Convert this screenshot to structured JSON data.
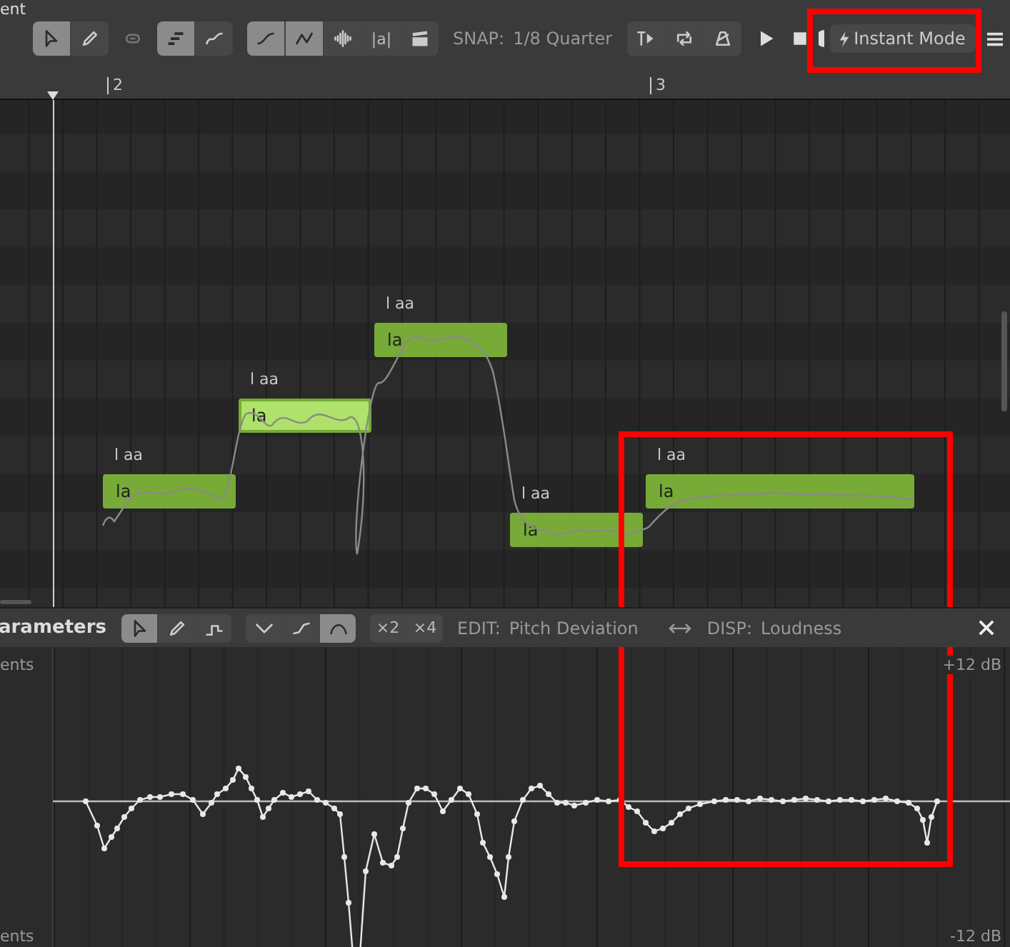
{
  "window": {
    "title": "ent"
  },
  "toolbar": {
    "groups": [
      {
        "tools": [
          {
            "kind": "select",
            "selected": true
          },
          {
            "kind": "pencil",
            "selected": false
          }
        ]
      },
      {
        "tools": [
          {
            "kind": "notes",
            "selected": true
          },
          {
            "kind": "pitch",
            "selected": false
          }
        ]
      },
      {
        "tools": [
          {
            "kind": "curve-smooth",
            "selected": true
          },
          {
            "kind": "curve-sharp",
            "selected": true
          },
          {
            "kind": "wave",
            "selected": false
          },
          {
            "kind": "text",
            "label": "|a|",
            "selected": false
          },
          {
            "kind": "clapper",
            "selected": false
          }
        ]
      }
    ],
    "snap_label": "SNAP:",
    "snap_value": "1/8 Quarter",
    "transport_tools": [
      {
        "kind": "cursor-play",
        "selected": false
      },
      {
        "kind": "loop",
        "selected": false
      },
      {
        "kind": "metronome",
        "selected": false
      }
    ],
    "instant_mode": "Instant Mode"
  },
  "ruler": {
    "markers": [
      "2",
      "3"
    ]
  },
  "notes": [
    {
      "lyric": "la",
      "phoneme": "l aa",
      "selected": false
    },
    {
      "lyric": "la",
      "phoneme": "l aa",
      "selected": true
    },
    {
      "lyric": "la",
      "phoneme": "l aa",
      "selected": false
    },
    {
      "lyric": "la",
      "phoneme": "l aa",
      "selected": false
    },
    {
      "lyric": "la",
      "phoneme": "l aa",
      "selected": false
    }
  ],
  "parameters": {
    "title": "arameters",
    "groups": [
      {
        "tools": [
          {
            "kind": "select",
            "selected": true
          },
          {
            "kind": "pencil",
            "selected": false
          },
          {
            "kind": "step",
            "selected": false
          }
        ]
      },
      {
        "tools": [
          {
            "kind": "dip",
            "selected": false
          },
          {
            "kind": "rise",
            "selected": false
          },
          {
            "kind": "arc",
            "selected": true
          }
        ]
      },
      {
        "tools": [
          {
            "kind": "text",
            "label": "×2",
            "selected": false
          },
          {
            "kind": "text",
            "label": "×4",
            "selected": false
          }
        ]
      }
    ],
    "edit_label": "EDIT:",
    "edit_value": "Pitch Deviation",
    "disp_label": "DISP:",
    "disp_value": "Loudness",
    "axis_left_top": "ents",
    "axis_left_bottom": "ents",
    "axis_right_top": "+12 dB",
    "axis_right_bottom": "-12 dB"
  }
}
